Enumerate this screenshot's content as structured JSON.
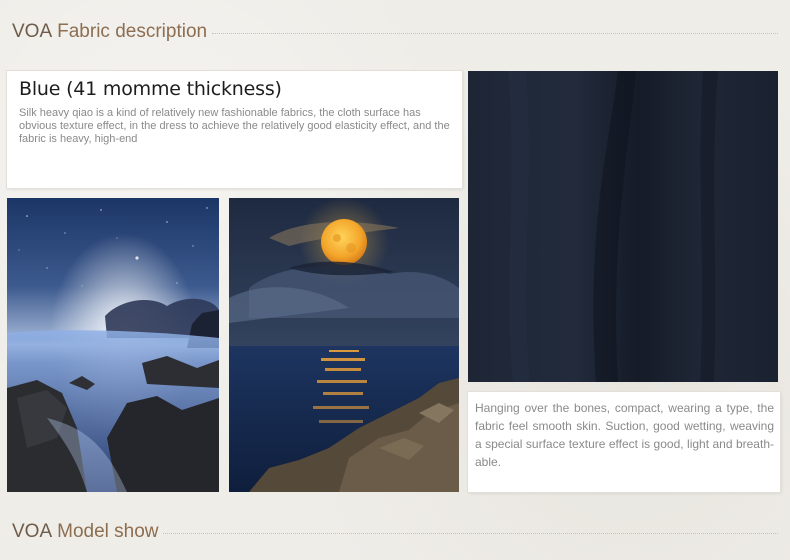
{
  "sections": {
    "fabric": {
      "brand": "VOA",
      "title": "Fabric description"
    },
    "model": {
      "brand": "VOA",
      "title": "Model show"
    }
  },
  "fabric_description": {
    "title": "Blue (41 momme thickness)",
    "text": "Silk heavy qiao is a kind of relatively new fashionable fabrics, the cloth surface has obvious texture effect, in the dress to achieve the relatively good elasticity effect, and the fabric is heavy, high-end"
  },
  "fabric_features": {
    "text": "Hanging over the bones, compact, wearing a type, the fabric feel smooth skin. Suction, good wetting, weaving a special surface texture effect is good, light and breath-able."
  },
  "colors": {
    "heading": "#8d6e51",
    "background": "#efede8",
    "fabric_navy": "#1a2130"
  },
  "images": [
    {
      "name": "night-sky-coast-photo"
    },
    {
      "name": "full-moon-sea-photo"
    },
    {
      "name": "navy-fabric-swatch-photo"
    }
  ]
}
